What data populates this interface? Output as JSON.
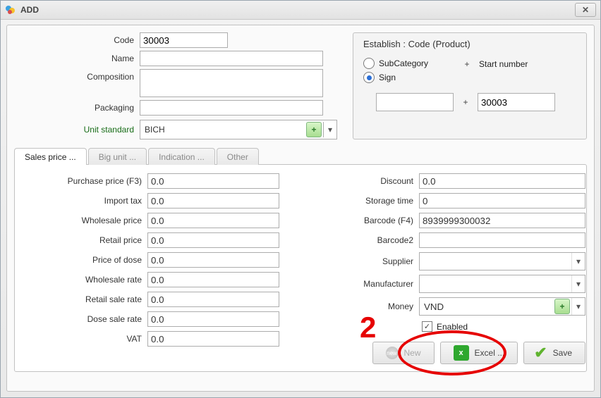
{
  "window": {
    "title": "ADD"
  },
  "top": {
    "code_label": "Code",
    "code_value": "30003",
    "name_label": "Name",
    "name_value": "",
    "composition_label": "Composition",
    "composition_value": "",
    "packaging_label": "Packaging",
    "packaging_value": "",
    "unit_label": "Unit standard",
    "unit_value": "BICH"
  },
  "establish": {
    "title": "Establish : Code (Product)",
    "radio_subcategory": "SubCategory",
    "radio_sign": "Sign",
    "plus": "+",
    "start_label": "Start number",
    "sign_value": "",
    "start_value": "30003"
  },
  "tabs": {
    "t1": "Sales price ...",
    "t2": "Big unit ...",
    "t3": "Indication ...",
    "t4": "Other"
  },
  "left": {
    "purchase_lbl": "Purchase price (F3)",
    "purchase_val": "0.0",
    "importtax_lbl": "Import tax",
    "importtax_val": "0.0",
    "wholesale_lbl": "Wholesale price",
    "wholesale_val": "0.0",
    "retail_lbl": "Retail price",
    "retail_val": "0.0",
    "dose_lbl": "Price of dose",
    "dose_val": "0.0",
    "wrate_lbl": "Wholesale rate",
    "wrate_val": "0.0",
    "rrate_lbl": "Retail sale rate",
    "rrate_val": "0.0",
    "drate_lbl": "Dose sale rate",
    "drate_val": "0.0",
    "vat_lbl": "VAT",
    "vat_val": "0.0"
  },
  "right": {
    "discount_lbl": "Discount",
    "discount_val": "0.0",
    "storage_lbl": "Storage time",
    "storage_val": "0",
    "barcode_lbl": "Barcode (F4)",
    "barcode_val": "8939999300032",
    "barcode2_lbl": "Barcode2",
    "barcode2_val": "",
    "supplier_lbl": "Supplier",
    "supplier_val": "",
    "manufacturer_lbl": "Manufacturer",
    "manufacturer_val": "",
    "money_lbl": "Money",
    "money_val": "VND",
    "enabled_lbl": "Enabled"
  },
  "buttons": {
    "new": "New",
    "excel": "Excel ...",
    "save": "Save"
  },
  "annotation": {
    "number": "2"
  }
}
